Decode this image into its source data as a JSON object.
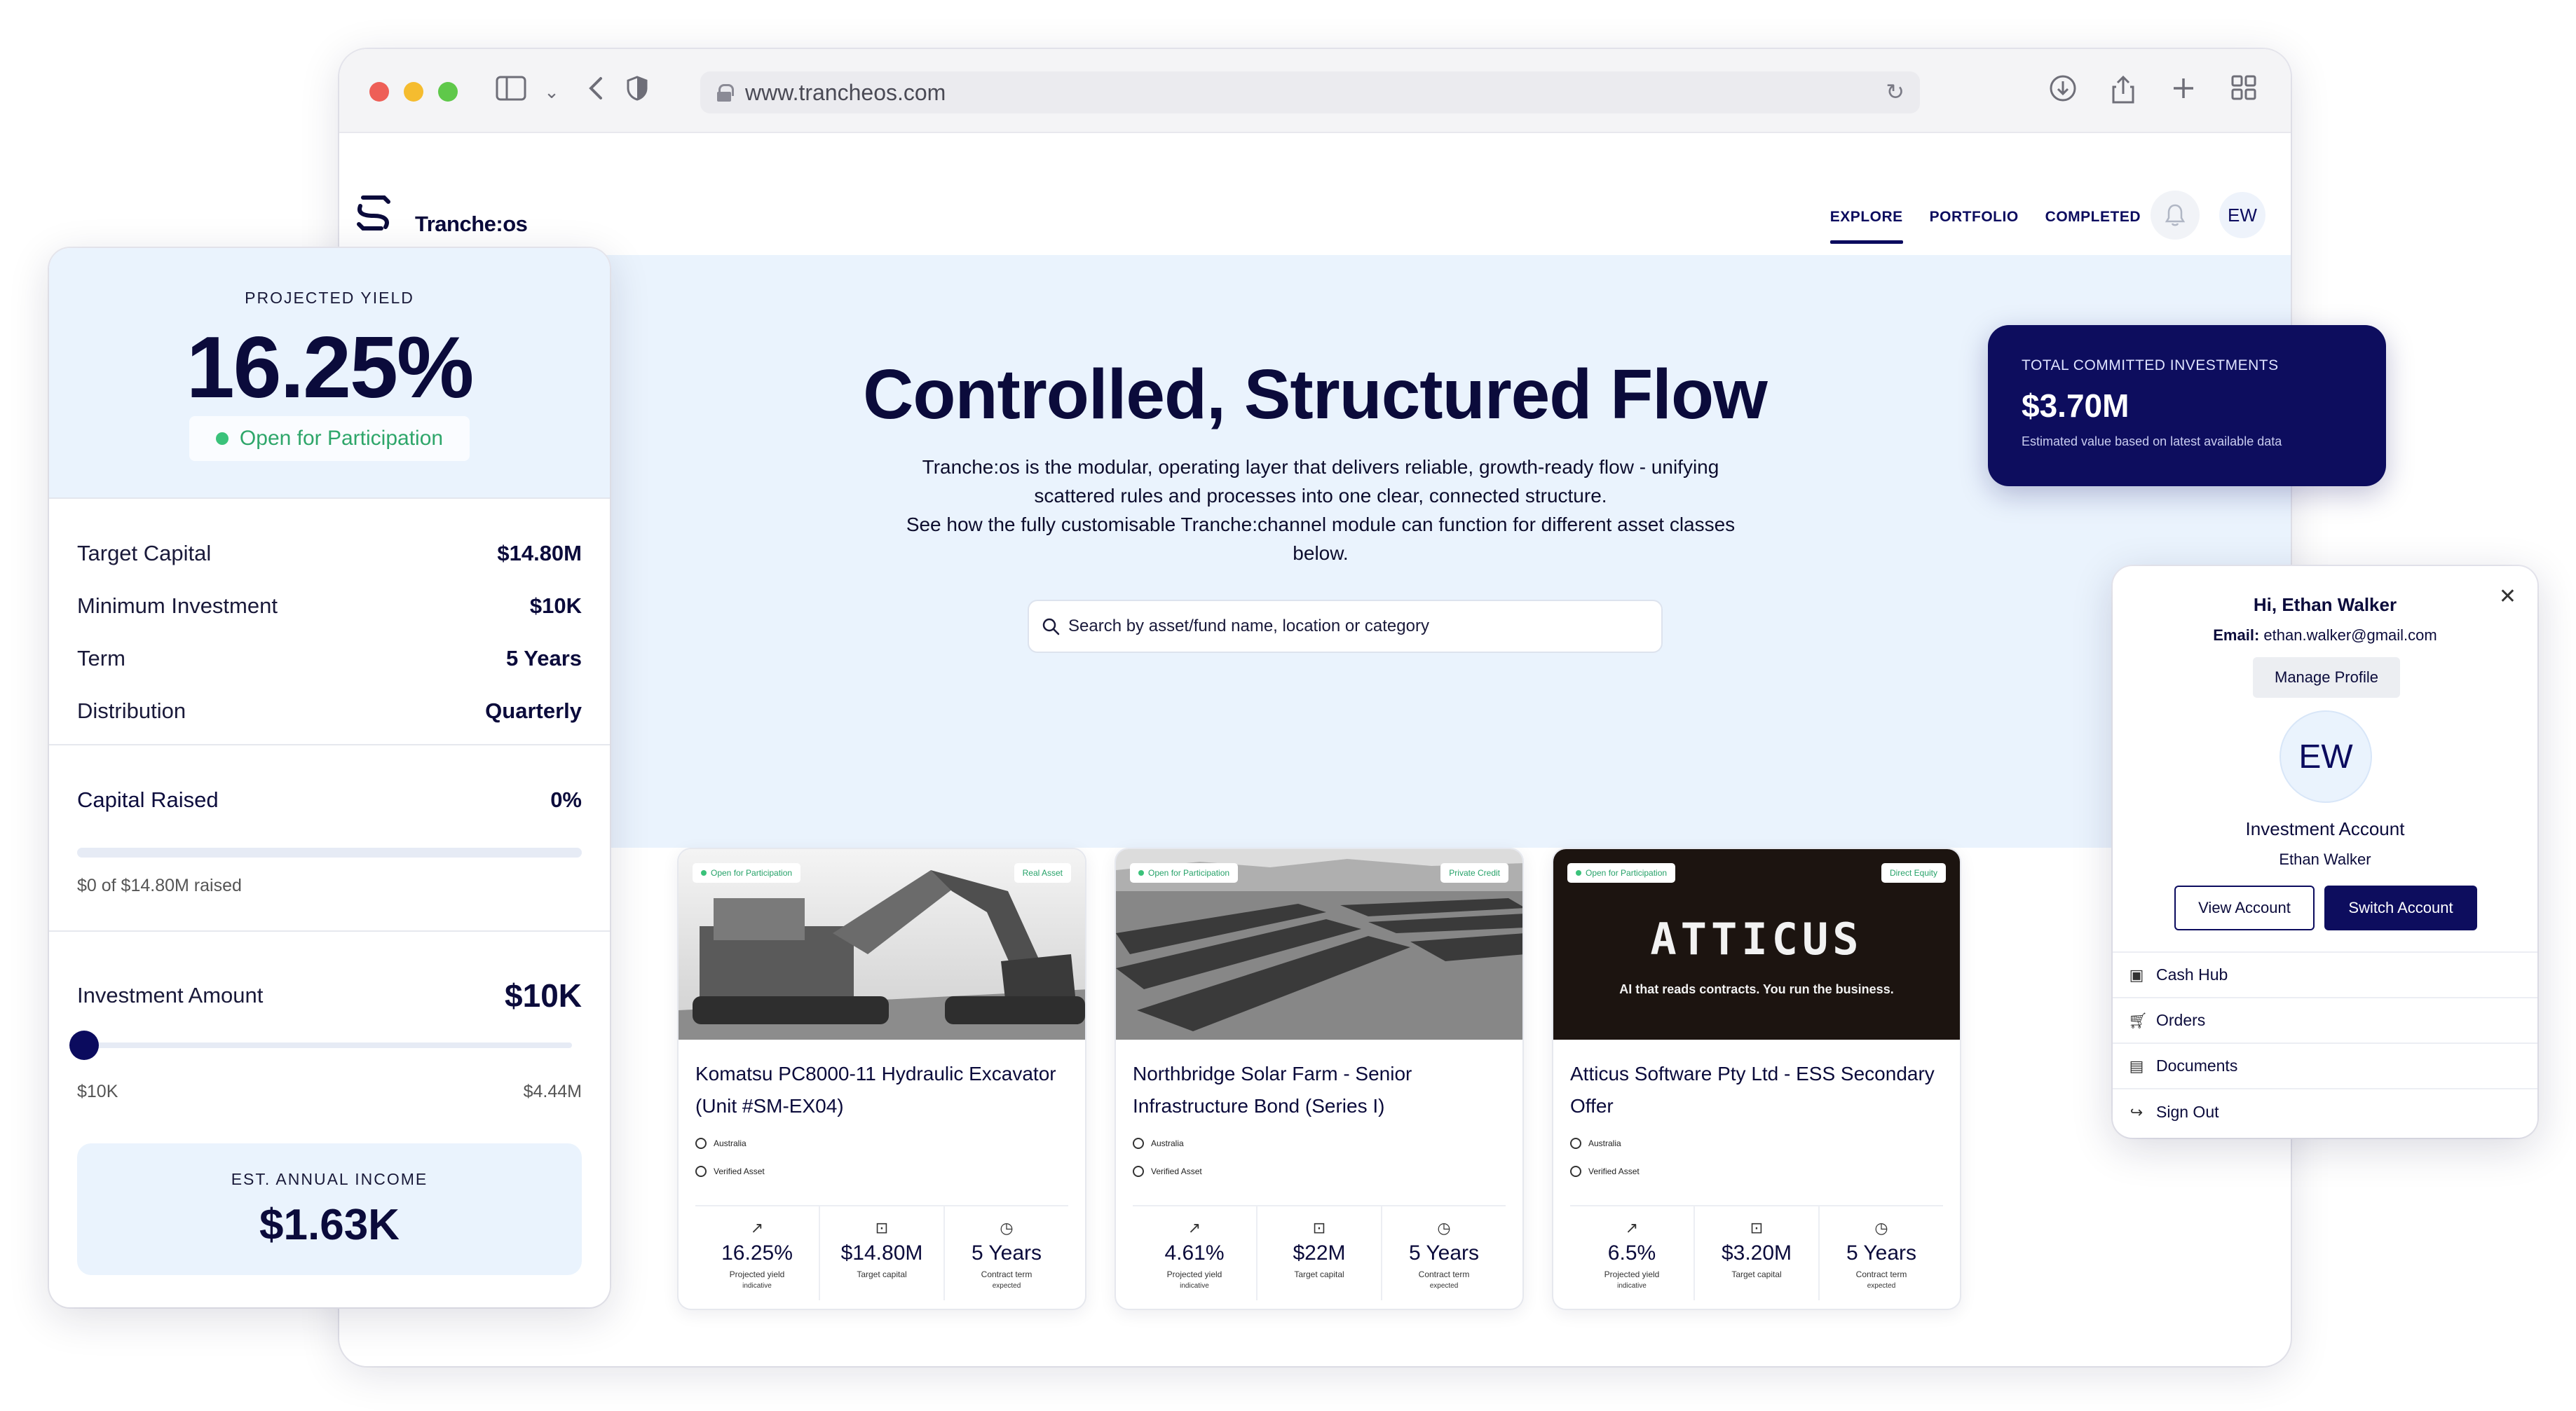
{
  "browser": {
    "url": "www.trancheos.com"
  },
  "app": {
    "brand": "Tranche:os",
    "nav": [
      {
        "label": "EXPLORE",
        "active": true
      },
      {
        "label": "PORTFOLIO",
        "active": false
      },
      {
        "label": "COMPLETED",
        "active": false
      }
    ],
    "user_initials": "EW"
  },
  "hero": {
    "title": "Controlled, Structured Flow",
    "paragraph_1": "Tranche:os is the modular, operating layer that delivers reliable, growth-ready flow - unifying scattered rules and processes into one clear, connected structure.",
    "paragraph_2": "See how the fully customisable Tranche:channel module can function for different asset classes below.",
    "search_placeholder": "Search by asset/fund name, location or category"
  },
  "committed": {
    "label": "TOTAL COMMITTED INVESTMENTS",
    "value": "$3.70M",
    "note": "Estimated value based on latest available data"
  },
  "cards": [
    {
      "status": "Open for Participation",
      "category": "Real Asset",
      "title": "Komatsu PC8000-11 Hydraulic Excavator (Unit #SM-EX04)",
      "location": "Australia",
      "verified": "Verified Asset",
      "yield": "16.25%",
      "yield_label": "Projected yield",
      "yield_note": "indicative",
      "capital": "$14.80M",
      "capital_label": "Target capital",
      "term": "5 Years",
      "term_label": "Contract term",
      "term_note": "expected"
    },
    {
      "status": "Open for Participation",
      "category": "Private Credit",
      "title": "Northbridge Solar Farm - Senior Infrastructure Bond (Series I)",
      "location": "Australia",
      "verified": "Verified Asset",
      "yield": "4.61%",
      "yield_label": "Projected yield",
      "yield_note": "indicative",
      "capital": "$22M",
      "capital_label": "Target capital",
      "term": "5 Years",
      "term_label": "Contract term",
      "term_note": "expected"
    },
    {
      "status": "Open for Participation",
      "category": "Direct Equity",
      "title": "Atticus Software Pty Ltd - ESS Secondary Offer",
      "location": "Australia",
      "verified": "Verified Asset",
      "image_logo": "ATTICUS",
      "image_tagline": "AI that reads contracts. You run the business.",
      "yield": "6.5%",
      "yield_label": "Projected yield",
      "yield_note": "indicative",
      "capital": "$3.20M",
      "capital_label": "Target capital",
      "term": "5 Years",
      "term_label": "Contract term",
      "term_note": "expected"
    }
  ],
  "panel": {
    "yield_label": "PROJECTED YIELD",
    "yield_value": "16.25%",
    "status": "Open for Participation",
    "terms": [
      {
        "key": "Target Capital",
        "value": "$14.80M"
      },
      {
        "key": "Minimum Investment",
        "value": "$10K"
      },
      {
        "key": "Term",
        "value": "5 Years"
      },
      {
        "key": "Distribution",
        "value": "Quarterly"
      }
    ],
    "capital_raised_label": "Capital Raised",
    "capital_raised_value": "0%",
    "capital_raised_fraction": 0,
    "raised_note": "$0 of $14.80M raised",
    "investment_label": "Investment Amount",
    "investment_value": "$10K",
    "slider_fraction": 0,
    "slider_min": "$10K",
    "slider_max": "$4.44M",
    "income_label": "EST. ANNUAL INCOME",
    "income_value": "$1.63K"
  },
  "profile": {
    "greeting": "Hi, Ethan Walker",
    "email_label": "Email:",
    "email": "ethan.walker@gmail.com",
    "manage": "Manage Profile",
    "initials": "EW",
    "account_type": "Investment Account",
    "account_name": "Ethan Walker",
    "view_button": "View Account",
    "switch_button": "Switch Account",
    "menu": [
      {
        "label": "Cash Hub",
        "icon": "wallet-icon"
      },
      {
        "label": "Orders",
        "icon": "cart-icon"
      },
      {
        "label": "Documents",
        "icon": "document-icon"
      },
      {
        "label": "Sign Out",
        "icon": "sign-out-icon"
      }
    ]
  },
  "colors": {
    "navy": "#0d0d5e",
    "hero_bg": "#eaf3fd",
    "green": "#3ac27a"
  }
}
